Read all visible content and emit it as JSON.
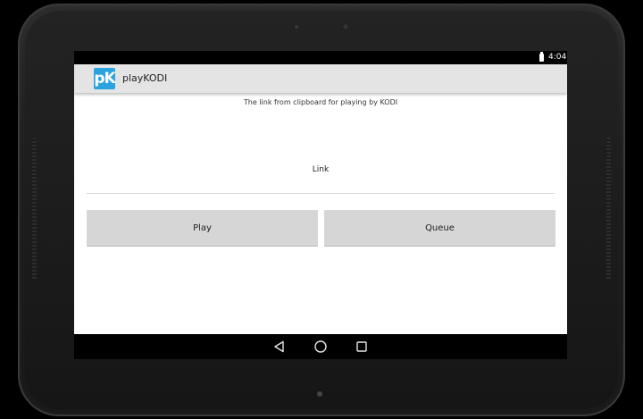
{
  "status_bar": {
    "time": "4:04",
    "battery_icon": "battery-full-icon"
  },
  "action_bar": {
    "logo_text": "pK",
    "app_title": "playKODI",
    "logo_color": "#2ba3e0"
  },
  "main": {
    "hint": "The link from clipboard for playing by KODI",
    "link_field": {
      "placeholder": "Link",
      "value": ""
    },
    "play_label": "Play",
    "queue_label": "Queue"
  },
  "nav_bar": {
    "back_icon": "back-triangle-icon",
    "home_icon": "home-circle-icon",
    "recents_icon": "recents-square-icon"
  }
}
